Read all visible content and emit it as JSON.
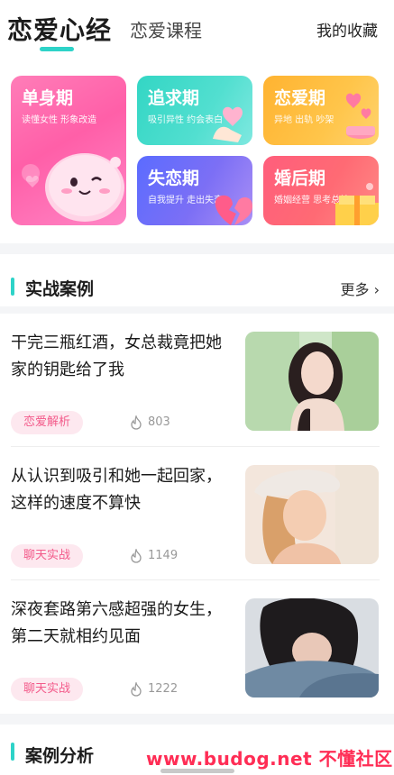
{
  "header": {
    "tab_active": "恋爱心经",
    "tab_inactive": "恋爱课程",
    "favorites": "我的收藏"
  },
  "categories": [
    {
      "title": "单身期",
      "subtitle": "读懂女性 形象改造"
    },
    {
      "title": "追求期",
      "subtitle": "吸引异性 约会表白"
    },
    {
      "title": "恋爱期",
      "subtitle": "异地 出轨 吵架"
    },
    {
      "title": "失恋期",
      "subtitle": "自我提升 走出失恋"
    },
    {
      "title": "婚后期",
      "subtitle": "婚姻经营 思考总结"
    }
  ],
  "cases_section": {
    "title": "实战案例",
    "more": "更多 ›"
  },
  "articles": [
    {
      "headline": "干完三瓶红酒，女总裁竟把她家的钥匙给了我",
      "tag": "恋爱解析",
      "views": "803"
    },
    {
      "headline": "从认识到吸引和她一起回家，这样的速度不算快",
      "tag": "聊天实战",
      "views": "1149"
    },
    {
      "headline": "深夜套路第六感超强的女生，第二天就相约见面",
      "tag": "聊天实战",
      "views": "1222"
    }
  ],
  "analysis_section": {
    "title": "案例分析"
  },
  "watermark": "www.budog.net 不懂社区",
  "colors": {
    "accent": "#2ed3c8",
    "tag_bg": "#fde8ef",
    "tag_text": "#f35a8a"
  }
}
